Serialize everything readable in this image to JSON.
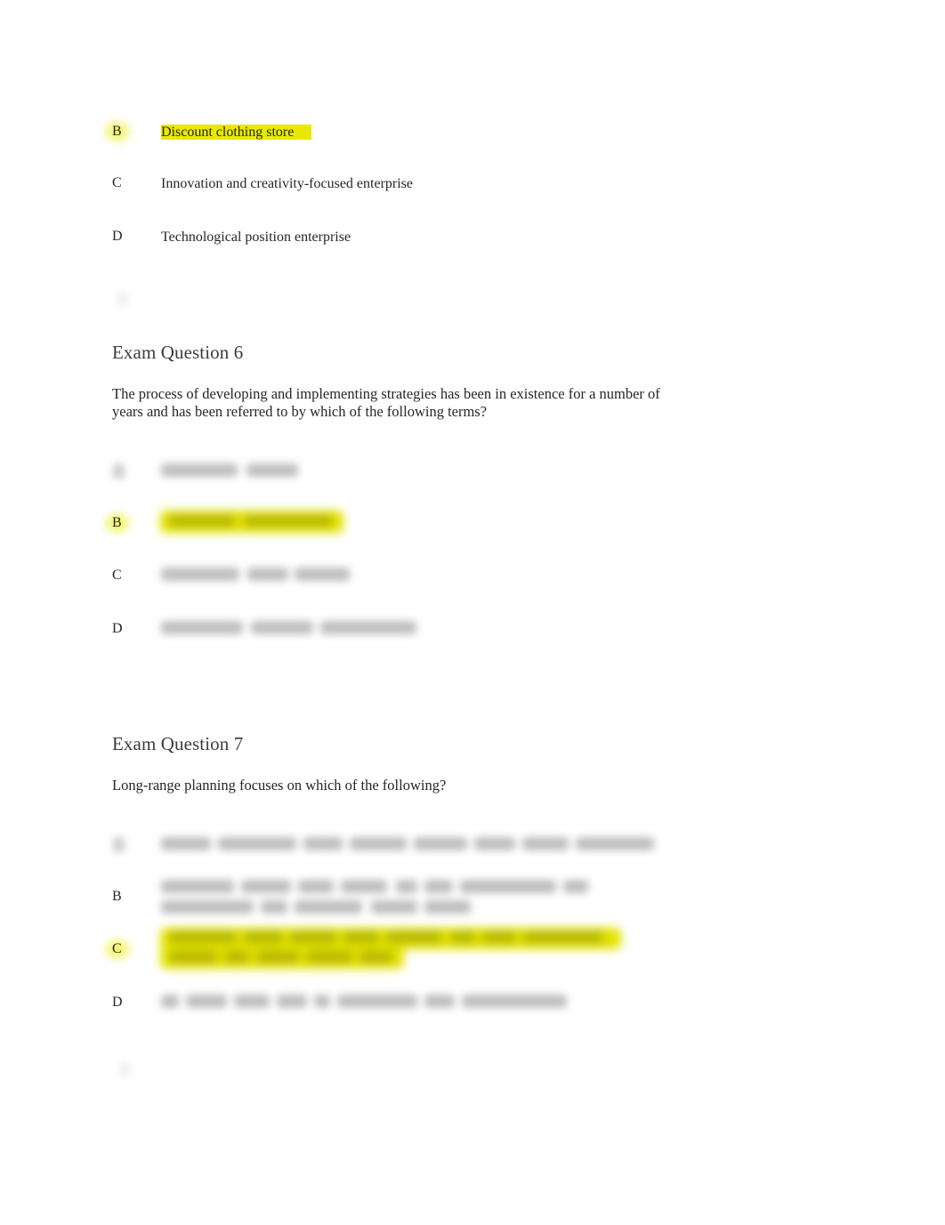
{
  "document": {
    "type": "exam-answer-key",
    "page_background": "#ffffff",
    "body_text_color": "#262626",
    "heading_text_color": "#3c3c3c",
    "highlight_color": "#e9e900"
  },
  "top_fragment": {
    "note": "continuation of the previous question's options",
    "options": [
      {
        "letter": "B",
        "text": "Discount clothing store",
        "highlighted": true,
        "legible": true
      },
      {
        "letter": "C",
        "text": "Innovation and creativity-focused enterprise",
        "highlighted": false,
        "legible": true
      },
      {
        "letter": "D",
        "text": "Technological position enterprise",
        "highlighted": false,
        "legible": true
      }
    ]
  },
  "questions": [
    {
      "heading": "Exam Question 6",
      "prompt": "The process of developing and implementing strategies has been in existence for a number of years and has been referred to by which of the following terms?",
      "options": [
        {
          "letter": "A",
          "text": "",
          "highlighted": false,
          "legible": false,
          "lines": 1
        },
        {
          "letter": "B",
          "text": "",
          "highlighted": true,
          "legible": false,
          "lines": 1
        },
        {
          "letter": "C",
          "text": "",
          "highlighted": false,
          "legible": false,
          "lines": 1
        },
        {
          "letter": "D",
          "text": "",
          "highlighted": false,
          "legible": false,
          "lines": 1
        }
      ]
    },
    {
      "heading": "Exam Question 7",
      "prompt": "Long-range planning focuses on which of the following?",
      "options": [
        {
          "letter": "A",
          "text": "",
          "highlighted": false,
          "legible": false,
          "lines": 1
        },
        {
          "letter": "B",
          "text": "",
          "highlighted": false,
          "legible": false,
          "lines": 2
        },
        {
          "letter": "C",
          "text": "",
          "highlighted": true,
          "legible": false,
          "lines": 2
        },
        {
          "letter": "D",
          "text": "",
          "highlighted": false,
          "legible": false,
          "lines": 1
        }
      ]
    }
  ]
}
